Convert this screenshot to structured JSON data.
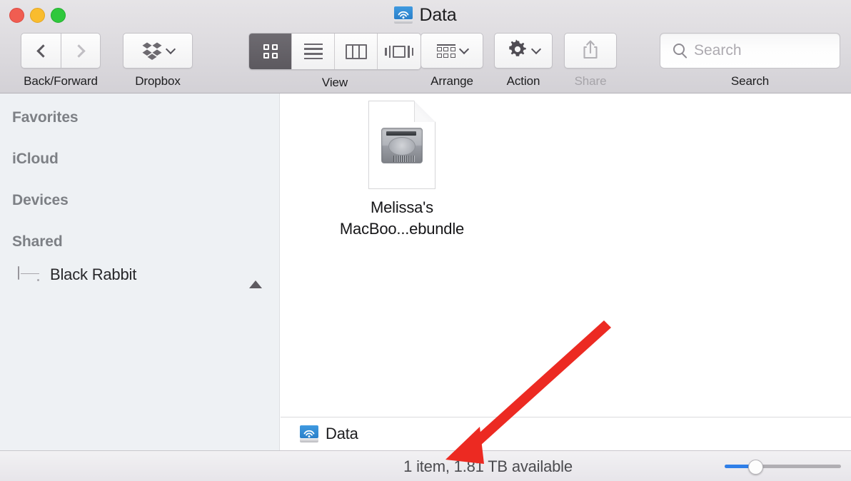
{
  "window": {
    "title": "Data",
    "title_icon": "network-drive-icon",
    "traffic_lights": [
      {
        "name": "close",
        "color": "#f05d51"
      },
      {
        "name": "minimize",
        "color": "#f9bc2e"
      },
      {
        "name": "maximize",
        "color": "#2fc83c"
      }
    ]
  },
  "toolbar": {
    "nav": {
      "label": "Back/Forward",
      "back_icon": "chevron-left-icon",
      "forward_icon": "chevron-right-icon"
    },
    "dropbox": {
      "label": "Dropbox",
      "icon": "dropbox-icon",
      "chevron": "chevron-down-icon"
    },
    "view": {
      "label": "View",
      "options": [
        {
          "name": "icon-view",
          "icon": "grid-icon",
          "selected": true
        },
        {
          "name": "list-view",
          "icon": "list-icon",
          "selected": false
        },
        {
          "name": "column-view",
          "icon": "columns-icon",
          "selected": false
        },
        {
          "name": "gallery-view",
          "icon": "coverflow-icon",
          "selected": false
        }
      ]
    },
    "arrange": {
      "label": "Arrange",
      "icon": "arrange-grid-icon",
      "chevron": "chevron-down-icon"
    },
    "action": {
      "label": "Action",
      "icon": "gear-icon",
      "chevron": "chevron-down-icon"
    },
    "share": {
      "label": "Share",
      "icon": "share-upload-icon",
      "disabled": true
    },
    "search": {
      "label": "Search",
      "placeholder": "Search",
      "value": "",
      "icon": "search-icon"
    }
  },
  "sidebar": {
    "sections": [
      {
        "header": "Favorites",
        "items": []
      },
      {
        "header": "iCloud",
        "items": []
      },
      {
        "header": "Devices",
        "items": []
      },
      {
        "header": "Shared",
        "items": [
          {
            "label": "Black Rabbit",
            "icon": "server-icon",
            "eject_icon": "eject-icon"
          }
        ]
      }
    ]
  },
  "content": {
    "files": [
      {
        "name": "Melissa's\nMacBoo...ebundle",
        "icon": "sparsebundle-document-icon"
      }
    ]
  },
  "pathbar": {
    "label": "Data",
    "icon": "network-drive-icon"
  },
  "statusbar": {
    "text": "1 item, 1.81 TB available",
    "zoom_slider": {
      "value": 25,
      "fill_color": "#2f7fe8"
    }
  },
  "annotation": {
    "arrow_color": "#ec2a22",
    "shape": "arrow-pointing-down-left"
  }
}
